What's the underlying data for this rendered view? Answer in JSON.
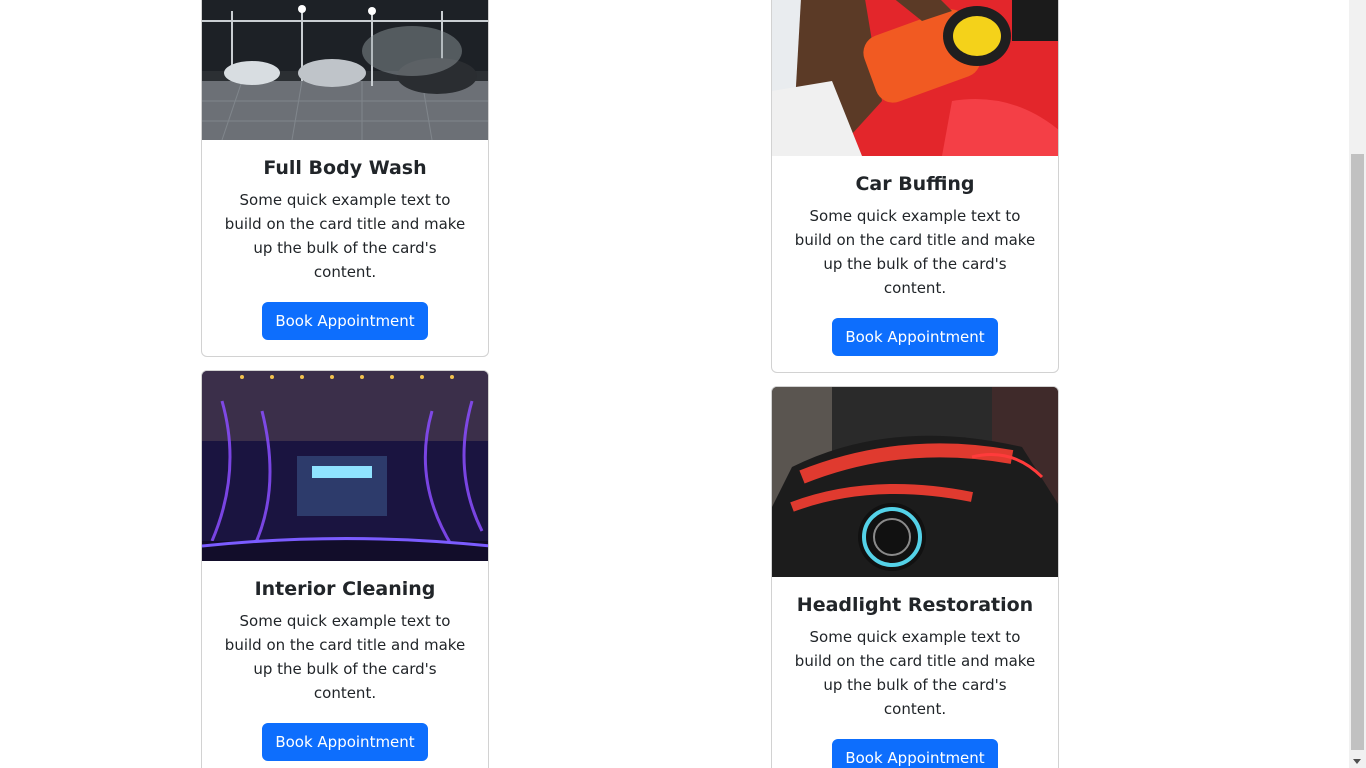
{
  "cards": [
    {
      "title": "Full Body Wash",
      "text": "Some quick example text to build on the card title and make up the bulk of the card's content.",
      "button": "Book Appointment",
      "image": "car-wash-bay-photo"
    },
    {
      "title": "Car Buffing",
      "text": "Some quick example text to build on the card title and make up the bulk of the card's content.",
      "button": "Book Appointment",
      "image": "car-polishing-photo"
    },
    {
      "title": "Interior Cleaning",
      "text": "Some quick example text to build on the card title and make up the bulk of the card's content.",
      "button": "Book Appointment",
      "image": "automatic-car-wash-tunnel-photo"
    },
    {
      "title": "Headlight Restoration",
      "text": "Some quick example text to build on the card title and make up the bulk of the card's content.",
      "button": "Book Appointment",
      "image": "red-sports-car-headlight-photo"
    }
  ],
  "colors": {
    "primary": "#0d6efd",
    "text": "#212529",
    "border": "#d9d9d9"
  }
}
